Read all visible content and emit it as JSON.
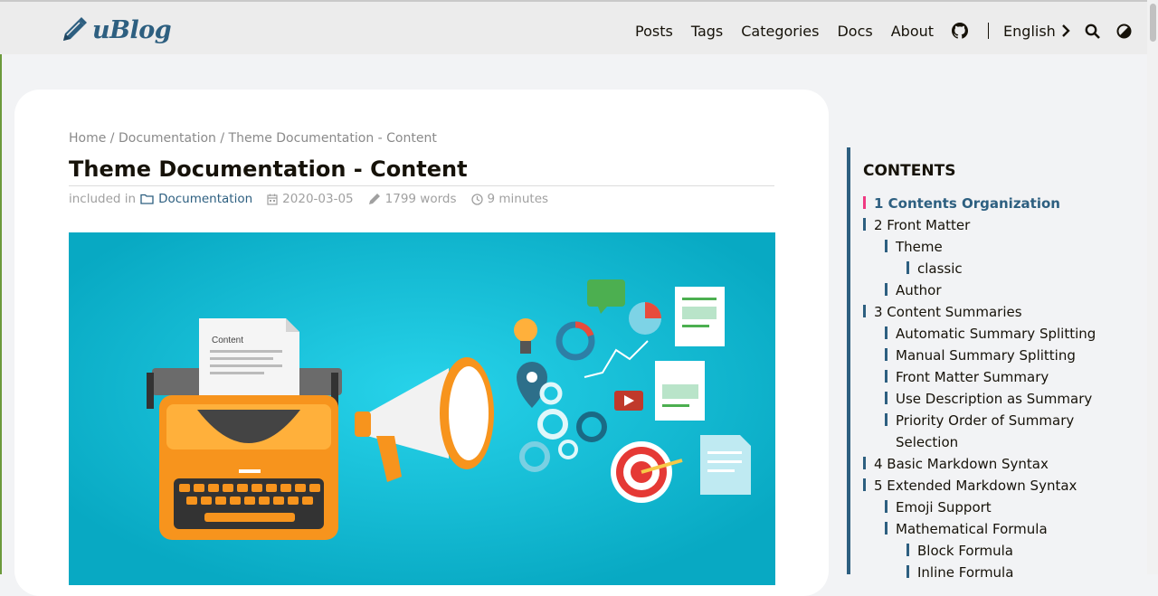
{
  "site": {
    "name": "uBlog"
  },
  "nav": {
    "items": [
      "Posts",
      "Tags",
      "Categories",
      "Docs",
      "About"
    ],
    "language": "English",
    "icons": [
      "github-icon",
      "chevron-right-icon",
      "search-icon",
      "theme-toggle-icon"
    ]
  },
  "breadcrumb": {
    "home": "Home",
    "sep1": "/",
    "section": "Documentation",
    "sep2": "/",
    "current": "Theme Documentation - Content"
  },
  "post": {
    "title": "Theme Documentation - Content",
    "included_in": "included in",
    "category": "Documentation",
    "date": "2020-03-05",
    "words": "1799 words",
    "reading_time": "9 minutes"
  },
  "hero": {
    "typewriter_paper_label": "Content"
  },
  "toc": {
    "heading": "CONTENTS",
    "items": [
      {
        "label": "1 Contents Organization",
        "level": 1,
        "active": true
      },
      {
        "label": "2 Front Matter",
        "level": 1
      },
      {
        "label": "Theme",
        "level": 2
      },
      {
        "label": "classic",
        "level": 3
      },
      {
        "label": "Author",
        "level": 2
      },
      {
        "label": "3 Content Summaries",
        "level": 1
      },
      {
        "label": "Automatic Summary Splitting",
        "level": 2
      },
      {
        "label": "Manual Summary Splitting",
        "level": 2
      },
      {
        "label": "Front Matter Summary",
        "level": 2
      },
      {
        "label": "Use Description as Summary",
        "level": 2
      },
      {
        "label": "Priority Order of Summary Selection",
        "level": 2
      },
      {
        "label": "4 Basic Markdown Syntax",
        "level": 1
      },
      {
        "label": "5 Extended Markdown Syntax",
        "level": 1
      },
      {
        "label": "Emoji Support",
        "level": 2
      },
      {
        "label": "Mathematical Formula",
        "level": 2
      },
      {
        "label": "Block Formula",
        "level": 3
      },
      {
        "label": "Inline Formula",
        "level": 3
      }
    ]
  },
  "colors": {
    "accent": "#2d5f80",
    "active_marker": "#ef3982",
    "hero_bg": "#12b8d0"
  }
}
